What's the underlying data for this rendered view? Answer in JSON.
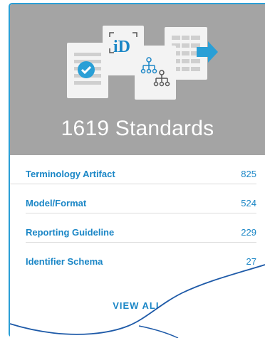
{
  "card": {
    "title": "1619 Standards",
    "hero_icons": [
      "checklist-icon",
      "identifier-schema-icon",
      "hierarchy-tree-icon",
      "export-table-icon"
    ],
    "categories": [
      {
        "label": "Terminology Artifact",
        "count": "825"
      },
      {
        "label": "Model/Format",
        "count": "524"
      },
      {
        "label": "Reporting Guideline",
        "count": "229"
      },
      {
        "label": "Identifier Schema",
        "count": "27"
      }
    ],
    "view_all_label": "VIEW ALL"
  },
  "colors": {
    "border": "#2a9fd6",
    "header_bg": "#a4a4a4",
    "link": "#1a86c6",
    "icon_blue": "#2a9fd6"
  }
}
